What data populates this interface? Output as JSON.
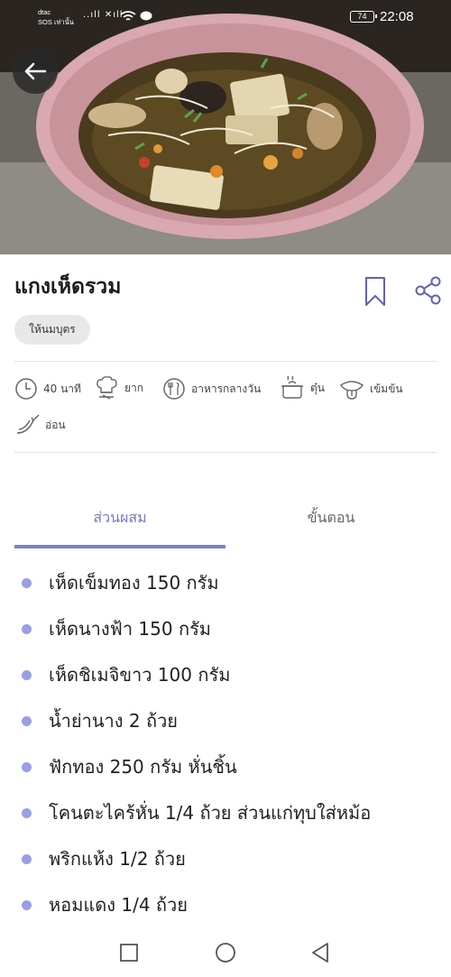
{
  "status_bar": {
    "carrier_line1": "dtac",
    "carrier_line2": "SOS เท่านั้น",
    "signal": "..ıll ✕ıll",
    "battery": "74",
    "time": "22:08"
  },
  "recipe": {
    "title": "แกงเห็ดรวม",
    "tag": "ให้นมบุตร"
  },
  "meta": {
    "time": {
      "icon": "clock-icon",
      "label": "40 นาที"
    },
    "difficulty": {
      "icon": "chef-hat-icon",
      "label": "ยาก"
    },
    "meal": {
      "icon": "fork-spoon-icon",
      "label": "อาหารกลางวัน"
    },
    "cooking_method": {
      "icon": "pot-icon",
      "label": "ตุ๋น"
    },
    "taste": {
      "icon": "tongue-icon",
      "label": "เข้มข้น"
    },
    "spiciness": {
      "icon": "chili-icon",
      "label": "อ่อน"
    }
  },
  "tabs": {
    "ingredients": "ส่วนผสม",
    "steps": "ขั้นตอน",
    "active": "ingredients"
  },
  "ingredients": [
    "เห็ดเข็มทอง 150 กรัม",
    "เห็ดนางฟ้า 150 กรัม",
    "เห็ดชิเมจิขาว 100 กรัม",
    "น้ำย่านาง 2 ถ้วย",
    "ฟักทอง 250 กรัม หั่นชิ้น",
    "โคนตะไคร้หั่น 1/4 ถ้วย ส่วนแก่ทุบใส่หม้อ",
    "พริกแห้ง 1/2 ถ้วย",
    "หอมแดง 1/4 ถ้วย"
  ],
  "colors": {
    "accent": "#7b7fd2",
    "bullet": "#9a9ee6",
    "chip_bg": "#e8e8e8"
  }
}
